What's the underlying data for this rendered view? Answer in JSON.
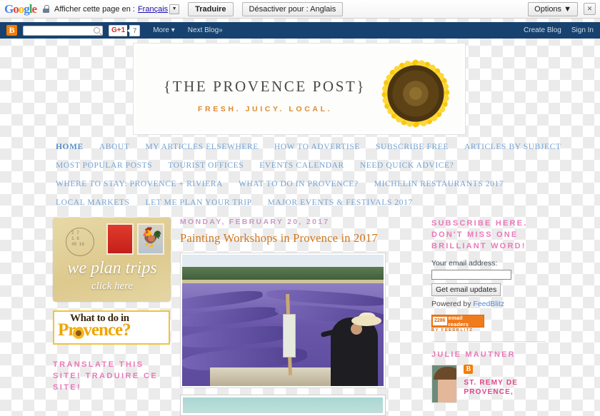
{
  "translate_bar": {
    "logo": "Google",
    "lock_icon": "lock-icon",
    "prompt": "Afficher cette page en :",
    "language": "Français",
    "translate_button": "Traduire",
    "disable_button": "Désactiver pour : Anglais",
    "options_button": "Options ▼",
    "close_button": "✕"
  },
  "blogger_nav": {
    "logo_letter": "B",
    "search_placeholder": "",
    "search_value": "",
    "gplus_label": "G+1",
    "gplus_count": "7",
    "more": "More ▾",
    "next_blog": "Next Blog»",
    "create_blog": "Create Blog",
    "sign_in": "Sign In"
  },
  "banner": {
    "title": "{THE PROVENCE POST}",
    "subtitle": "FRESH. JUICY. LOCAL.",
    "image_icon": "sunflower-icon"
  },
  "nav_menu": {
    "rows": [
      [
        "HOME",
        "ABOUT",
        "MY ARTICLES ELSEWHERE",
        "HOW TO ADVERTISE",
        "SUBSCRIBE FREE",
        "ARTICLES BY SUBJECT"
      ],
      [
        "MOST POPULAR POSTS",
        "TOURIST OFFICES",
        "EVENTS CALENDAR",
        "NEED QUICK ADVICE?"
      ],
      [
        "WHERE TO STAY: PROVENCE + RIVIERA",
        "WHAT TO DO IN PROVENCE?",
        "MICHELIN RESTAURANTS 2017"
      ],
      [
        "LOCAL MARKETS",
        "LET ME PLAN YOUR TRIP",
        "MAJOR EVENTS & FESTIVALS 2017"
      ]
    ],
    "active": "HOME",
    "link_color": "#74a3d4"
  },
  "left_sidebar": {
    "postcard": {
      "line1": "we plan trips",
      "line2": "click here",
      "stamp_icon": "postage-stamp-icon",
      "rooster_icon": "rooster-icon",
      "postmark_text": "2 7\n1 6\n45 16"
    },
    "what_to_do_banner": {
      "line1": "What to do in",
      "line2": "Provence?",
      "sun_icon": "sunflower-icon"
    },
    "translate_heading": "TRANSLATE THIS SITE! TRADUIRE CE SITE!"
  },
  "main": {
    "post_date": "MONDAY, FEBRUARY 20, 2017",
    "post_title": "Painting Workshops in Provence in 2017",
    "post_image_alt": "painter-at-easel-in-lavender-field"
  },
  "right_sidebar": {
    "subscribe_heading": "SUBSCRIBE HERE. DON'T MISS ONE BRILLIANT WORD!",
    "email_label": "Your email address:",
    "email_value": "",
    "email_placeholder": "",
    "subscribe_button": "Get email updates",
    "powered_prefix": "Powered by ",
    "powered_link": "FeedBlitz",
    "badge_count": "2286",
    "badge_text": "email readers",
    "badge_sub": "BY FEEDBLITZ",
    "author_heading": "JULIE MAUTNER",
    "author_photo_alt": "author-portrait",
    "blogger_icon_letter": "B",
    "author_location": "ST. REMY DE PROVENCE,"
  },
  "colors": {
    "blogger_navbar": "#17426f",
    "accent_pink": "#e87ab8",
    "accent_orange": "#d0761f",
    "nav_blue": "#74a3d4",
    "blogger_orange": "#f57d00"
  }
}
